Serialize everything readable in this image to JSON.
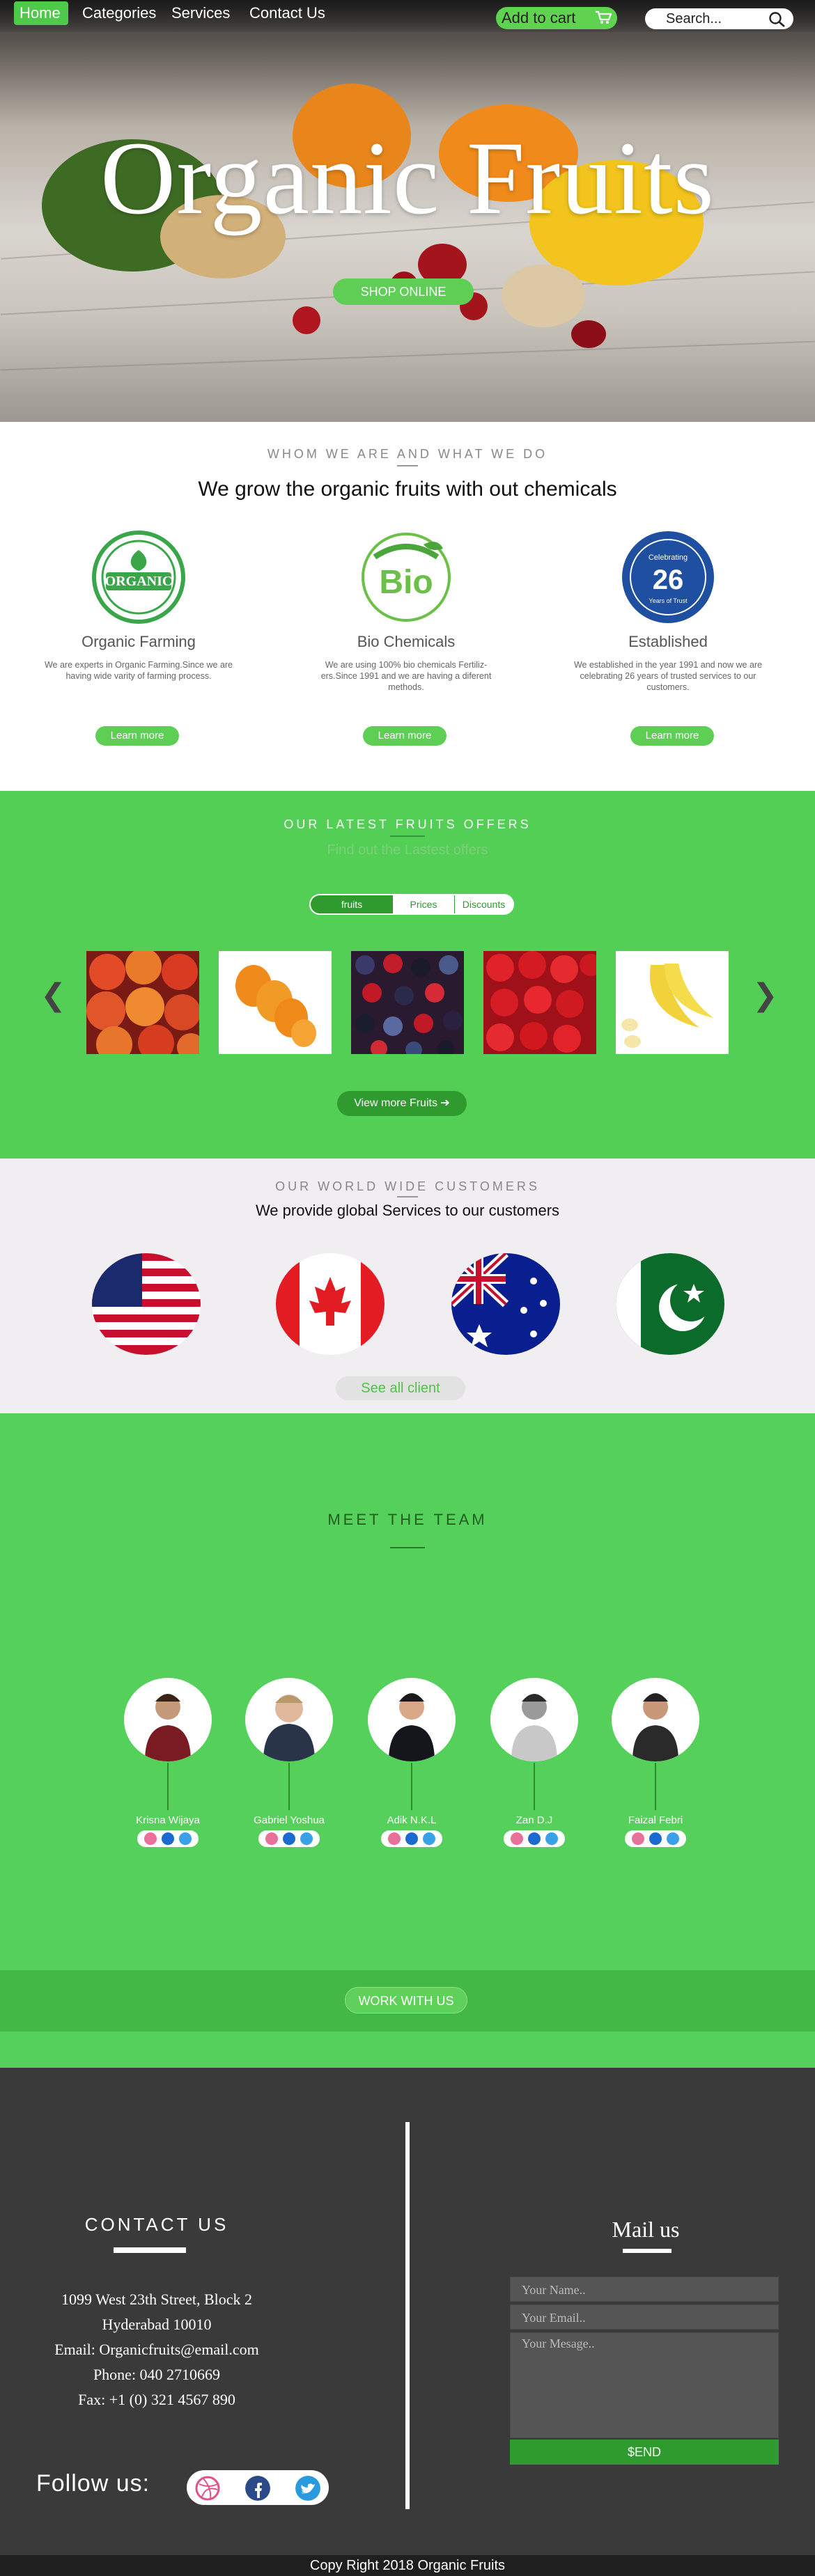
{
  "nav": {
    "home": "Home",
    "categories": "Categories",
    "services": "Services",
    "contact": "Contact Us",
    "cart": "Add to cart",
    "search_placeholder": "Search..."
  },
  "hero": {
    "title": "Organic Fruits",
    "button": "SHOP ONLINE"
  },
  "about": {
    "subtitle": "WHOM WE ARE AND WHAT WE DO",
    "title": "We grow the organic fruits with out chemicals",
    "features": [
      {
        "badge": "ORGANIC",
        "name": "Organic Farming",
        "desc": "We are experts in Organic Farming.Since we are having wide varity of farming process.",
        "button": "Learn more"
      },
      {
        "badge": "Bio",
        "name": "Bio Chemicals",
        "desc": "We are using 100% bio chemicals Fertiliz-ers.Since 1991 and we are having a diferent methods.",
        "button": "Learn more"
      },
      {
        "badge": "26",
        "badge_top": "Celebrating",
        "badge_bottom": "Years of Trust",
        "name": "Established",
        "desc": "We established in the year 1991 and now we are celebrating 26 years of trusted services to our customers.",
        "button": "Learn more"
      }
    ]
  },
  "offers": {
    "title": "OUR LATEST FRUITS OFFERS",
    "subtitle": "Find out the Lastest offers",
    "tabs": [
      "fruits",
      "Prices",
      "Discounts"
    ],
    "prev": "❮",
    "next": "❯",
    "button": "View more Fruits"
  },
  "customers": {
    "subtitle": "OUR WORLD WIDE CUSTOMERS",
    "title": "We provide global Services to our  customers",
    "button": "See all client"
  },
  "team": {
    "title": "MEET THE TEAM",
    "members": [
      {
        "name": "Krisna Wijaya"
      },
      {
        "name": "Gabriel Yoshua"
      },
      {
        "name": "Adik N.K.L"
      },
      {
        "name": "Zan D.J"
      },
      {
        "name": "Faizal Febri"
      }
    ],
    "button": "WORK WITH US"
  },
  "contact": {
    "title": "CONTACT US",
    "lines": [
      "1099 West 23th Street, Block 2",
      "Hyderabad 10010",
      "Email: Organicfruits@email.com",
      "Phone: 040 2710669",
      "Fax: +1 (0) 321 4567 890"
    ],
    "follow": "Follow us:"
  },
  "mail": {
    "title": "Mail us",
    "name_placeholder": "Your Name..",
    "email_placeholder": "Your Email..",
    "message_placeholder": "Your Mesage..",
    "send": "$END"
  },
  "footer": {
    "copyright": "Copy Right 2018 Organic Fruits"
  },
  "colors": {
    "green": "#53cf56",
    "dark_green": "#2f9a2d",
    "dark": "#3a3a3a"
  }
}
